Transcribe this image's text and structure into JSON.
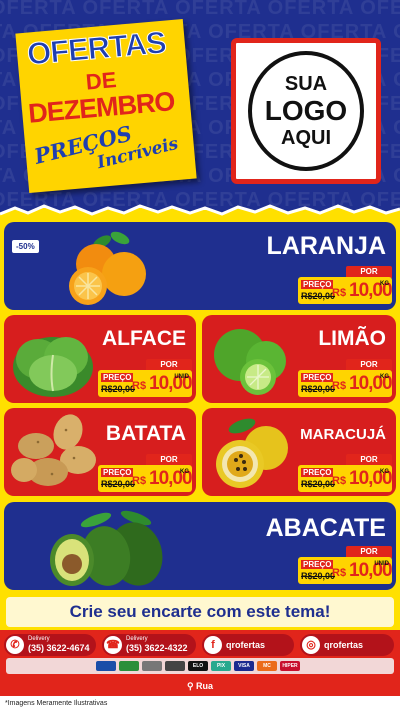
{
  "header": {
    "bg_word": "OFERTA",
    "title_line1": "OFERTAS",
    "title_line2": "DE",
    "title_line3": "DEZEMBRO",
    "subtitle_line1": "PREÇOS",
    "subtitle_line2": "Incríveis",
    "logo": {
      "line1": "SUA",
      "line2": "LOGO",
      "line3": "AQUI"
    }
  },
  "colors": {
    "blue": "#1f2f8f",
    "red": "#d71e1e",
    "yellow": "#ffe000"
  },
  "products": [
    {
      "name": "LARANJA",
      "discount": "-50%",
      "preco_label": "PREÇO",
      "por_label": "POR",
      "old_price": "R$20,00",
      "currency": "R$",
      "price": "10,00",
      "unit": "KG",
      "icon": "orange-icon"
    },
    {
      "name": "ALFACE",
      "preco_label": "PREÇO",
      "por_label": "POR",
      "old_price": "R$20,00",
      "currency": "R$",
      "price": "10,00",
      "unit": "UNID",
      "icon": "lettuce-icon"
    },
    {
      "name": "LIMÃO",
      "preco_label": "PREÇO",
      "por_label": "POR",
      "old_price": "R$20,00",
      "currency": "R$",
      "price": "10,00",
      "unit": "KG",
      "icon": "lime-icon"
    },
    {
      "name": "BATATA",
      "preco_label": "PREÇO",
      "por_label": "POR",
      "old_price": "R$20,00",
      "currency": "R$",
      "price": "10,00",
      "unit": "KG",
      "icon": "potato-icon"
    },
    {
      "name": "MARACUJÁ",
      "preco_label": "PREÇO",
      "por_label": "POR",
      "old_price": "R$20,00",
      "currency": "R$",
      "price": "10,00",
      "unit": "KG",
      "icon": "passionfruit-icon"
    },
    {
      "name": "ABACATE",
      "preco_label": "PREÇO",
      "por_label": "POR",
      "old_price": "R$20,00",
      "currency": "R$",
      "price": "10,00",
      "unit": "UNID",
      "icon": "avocado-icon"
    }
  ],
  "cta": "Crie seu encarte com este tema!",
  "footer": {
    "contacts": [
      {
        "small": "Delivery",
        "value": "(35) 3622-4674",
        "icon": "whatsapp-icon"
      },
      {
        "small": "Delivery",
        "value": "(35) 3622-4322",
        "icon": "phone-icon"
      },
      {
        "value": "qrofertas",
        "icon": "facebook-icon"
      },
      {
        "value": "qrofertas",
        "icon": "instagram-icon"
      }
    ],
    "payments": [
      "VISA",
      "MC",
      "ELO",
      "PIX",
      "HIPER"
    ],
    "address": "Rua",
    "disclaimer": "*Imagens Meramente Ilustrativas"
  }
}
